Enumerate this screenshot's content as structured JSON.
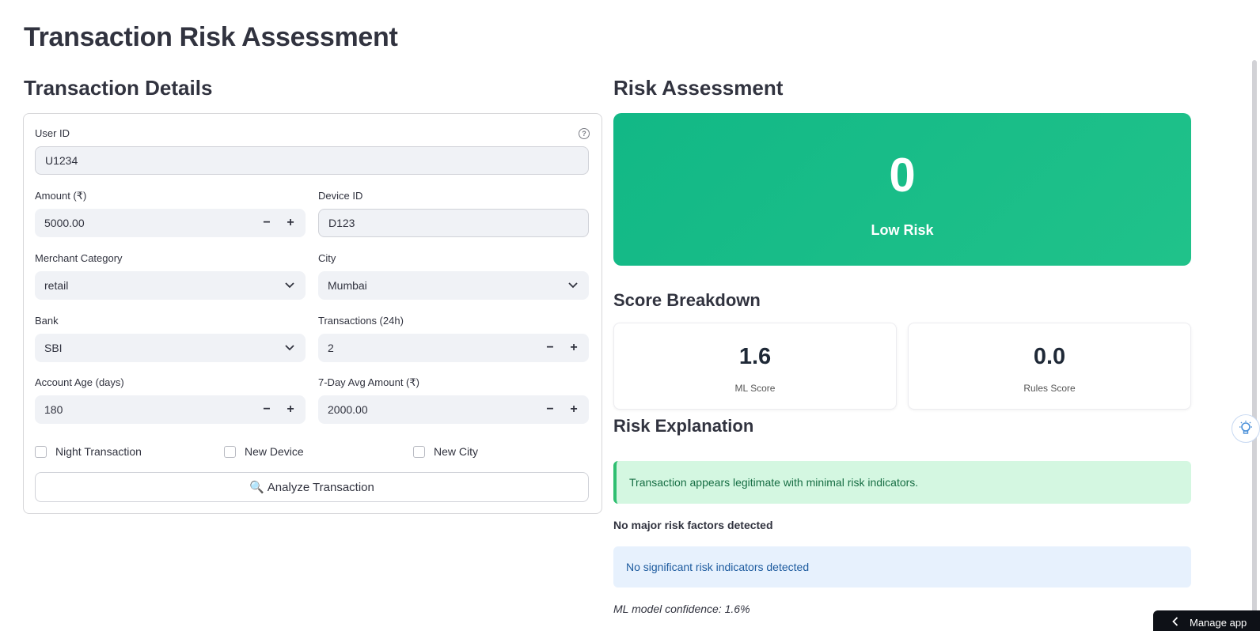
{
  "page": {
    "title": "Transaction Risk Assessment"
  },
  "form": {
    "section_title": "Transaction Details",
    "user_id": {
      "label": "User ID",
      "value": "U1234",
      "help_icon": "question-circle-icon"
    },
    "amount": {
      "label": "Amount (₹)",
      "value": "5000.00",
      "minus": "−",
      "plus": "+"
    },
    "device_id": {
      "label": "Device ID",
      "value": "D123"
    },
    "merchant_category": {
      "label": "Merchant Category",
      "value": "retail"
    },
    "city": {
      "label": "City",
      "value": "Mumbai"
    },
    "bank": {
      "label": "Bank",
      "value": "SBI"
    },
    "transactions_24h": {
      "label": "Transactions (24h)",
      "value": "2",
      "minus": "−",
      "plus": "+"
    },
    "account_age": {
      "label": "Account Age (days)",
      "value": "180",
      "minus": "−",
      "plus": "+"
    },
    "avg_amount_7d": {
      "label": "7-Day Avg Amount (₹)",
      "value": "2000.00",
      "minus": "−",
      "plus": "+"
    },
    "checkboxes": [
      {
        "label": "Night Transaction",
        "checked": false
      },
      {
        "label": "New Device",
        "checked": false
      },
      {
        "label": "New City",
        "checked": false
      }
    ],
    "analyze_button": {
      "icon": "🔍",
      "label": "Analyze Transaction"
    }
  },
  "assessment": {
    "section_title": "Risk Assessment",
    "risk_score": "0",
    "risk_level": "Low Risk",
    "risk_color": "#1dbf87",
    "breakdown_title": "Score Breakdown",
    "ml_score": {
      "value": "1.6",
      "label": "ML Score"
    },
    "rules_score": {
      "value": "0.0",
      "label": "Rules Score"
    },
    "explanation_title": "Risk Explanation",
    "success_message": "Transaction appears legitimate with minimal risk indicators.",
    "factors_text": "No major risk factors detected",
    "info_message": "No significant risk indicators detected",
    "confidence_text": "ML model confidence: 1.6%"
  },
  "footer": {
    "manage_app_label": "Manage app"
  }
}
